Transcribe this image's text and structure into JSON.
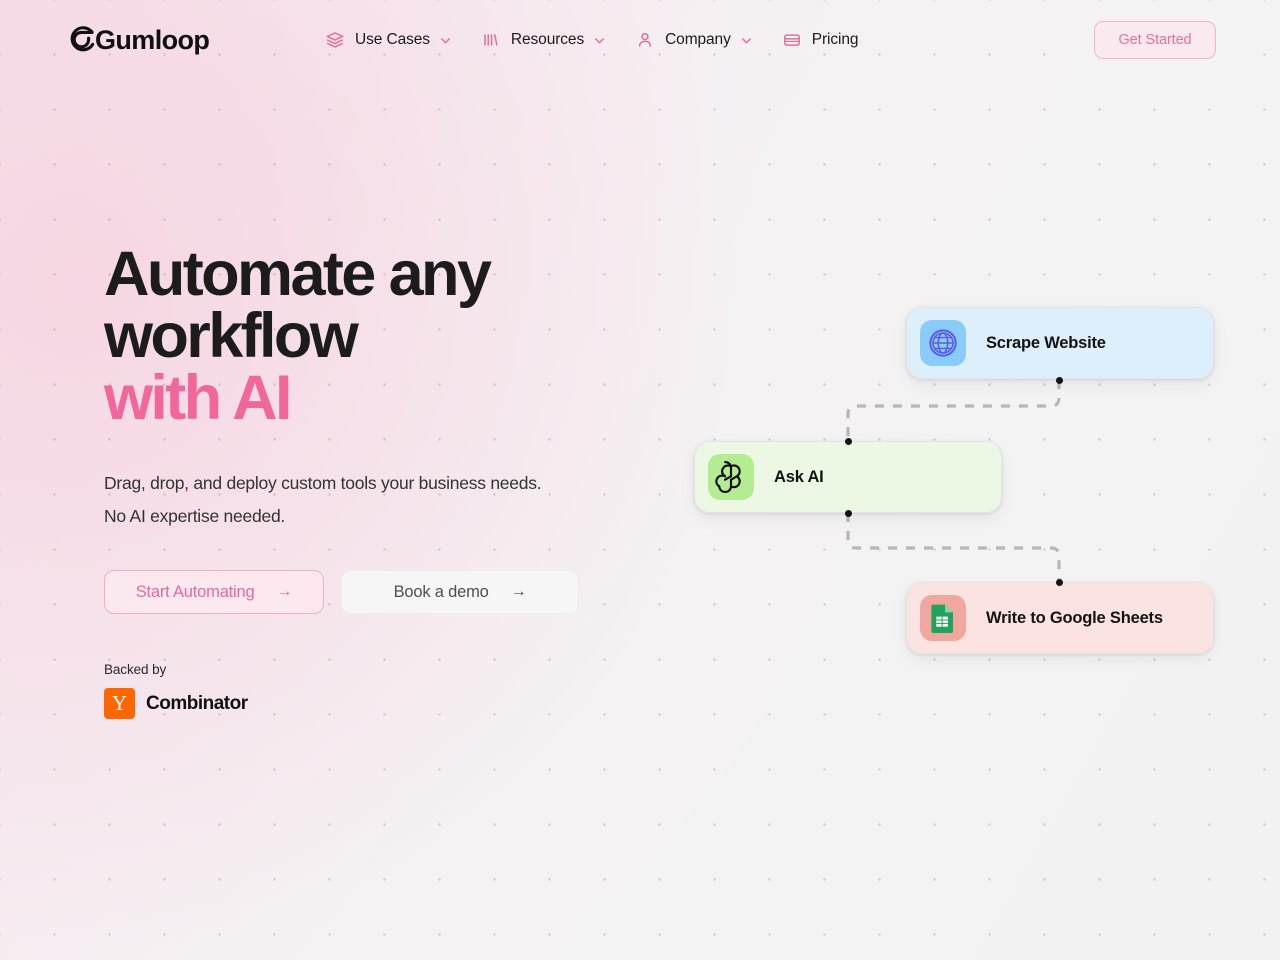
{
  "header": {
    "logo_text": "Gumloop",
    "logo_icon": "gumloop-spiral-g-icon",
    "nav_items": [
      {
        "label": "Use Cases",
        "icon": "layers-stack-icon",
        "has_chevron": true
      },
      {
        "label": "Resources",
        "icon": "bar-lines-icon",
        "has_chevron": true
      },
      {
        "label": "Company",
        "icon": "person-icon",
        "has_chevron": true
      },
      {
        "label": "Pricing",
        "icon": "credit-card-icon",
        "has_chevron": false
      }
    ],
    "cta_label": "Get Started"
  },
  "hero": {
    "headline_line1": "Automate any",
    "headline_line2": "workflow",
    "headline_accent": "with AI",
    "accent_color": "#f2679a",
    "subtext_line1": "Drag, drop, and deploy custom tools your business needs.",
    "subtext_line2": "No AI expertise needed.",
    "primary_cta": "Start Automating",
    "primary_cta_arrow": "→",
    "secondary_cta": "Book a demo",
    "secondary_cta_arrow": "→",
    "backed_by_label": "Backed by",
    "investor_mark": "Y",
    "investor_name": "Combinator",
    "investor_mark_color": "#ff6600"
  },
  "workflow": {
    "nodes": [
      {
        "label": "Scrape Website",
        "icon": "globe-icon",
        "card_color": "#ddeffb",
        "icon_bg": "#89cbfa"
      },
      {
        "label": "Ask AI",
        "icon": "openai-logo-icon",
        "card_color": "#ecf8e4",
        "icon_bg": "#b4ec92"
      },
      {
        "label": "Write to Google Sheets",
        "icon": "google-sheets-icon",
        "card_color": "#fbe3e1",
        "icon_bg": "#f0a79f"
      }
    ],
    "connector_style": "dashed",
    "connector_color": "#b6b6b6"
  }
}
